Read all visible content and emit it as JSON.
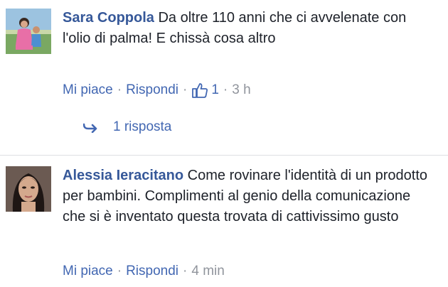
{
  "comments": [
    {
      "author": "Sara Coppola",
      "text": "Da oltre 110 anni che ci avvelenate con l'olio di palma! E chissà cosa altro",
      "like_label": "Mi piace",
      "reply_label": "Rispondi",
      "likes_count": "1",
      "time": "3 h",
      "replies_label": "1 risposta",
      "avatar_icon": "user-photo"
    },
    {
      "author": "Alessia Ieracitano",
      "text": "Come rovinare l'identità di un prodotto per bambini. Complimenti al genio della comunicazione che si è inventato questa trovata di cattivissimo gusto",
      "like_label": "Mi piace",
      "reply_label": "Rispondi",
      "time": "4 min",
      "avatar_icon": "user-photo"
    }
  ],
  "colors": {
    "link": "#4267b2",
    "author": "#365899",
    "muted": "#90949c",
    "text": "#1d2129",
    "divider": "#dddfe2"
  }
}
